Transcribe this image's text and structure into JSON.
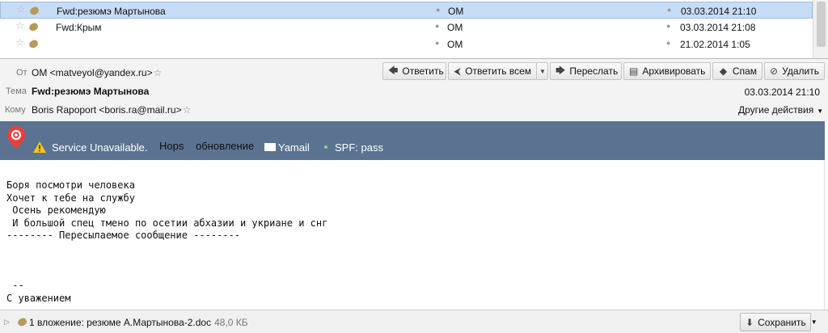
{
  "message_list": {
    "rows": [
      {
        "subject": "Fwd:резюмэ Мартынова",
        "from": "OM",
        "date": "03.03.2014 21:10",
        "selected": true
      },
      {
        "subject": "Fwd:Крым",
        "from": "OM",
        "date": "03.03.2014 21:08",
        "selected": false
      },
      {
        "subject": "",
        "from": "OM",
        "date": "21.02.2014 1:05",
        "selected": false
      }
    ]
  },
  "header": {
    "from_label": "От",
    "from_value": "OM <matveyol@yandex.ru>",
    "subject_label": "Тема",
    "subject_value": "Fwd:резюмэ Мартынова",
    "to_label": "Кому",
    "to_value": "Boris Rapoport <boris.ra@mail.ru>",
    "date": "03.03.2014 21:10",
    "more_actions": "Другие действия"
  },
  "toolbar": {
    "reply": "Ответить",
    "reply_all": "Ответить всем",
    "forward": "Переслать",
    "archive": "Архивировать",
    "spam": "Спам",
    "delete": "Удалить"
  },
  "extension_bar": {
    "service_status": "Service Unavailable.",
    "hops": "Hops",
    "update": "обновление",
    "yamail": "Yamail",
    "spf": "SPF: pass"
  },
  "body_text": "Боря посмотри человека\nХочет к тебе на службу\n Осень рекомендую\n И большой спец тмено по осетии абхазии и укриане и снг\n-------- Пересылаемое сообщение --------\n\n\n\n --\nС уважением",
  "attachment": {
    "text": "1 вложение: резюме А.Мартынова-2.doc",
    "size": "48,0 КБ",
    "save_label": "Сохранить"
  },
  "colors": {
    "selected_row": "#c7dcf7",
    "extension_bar": "#5b7391"
  }
}
